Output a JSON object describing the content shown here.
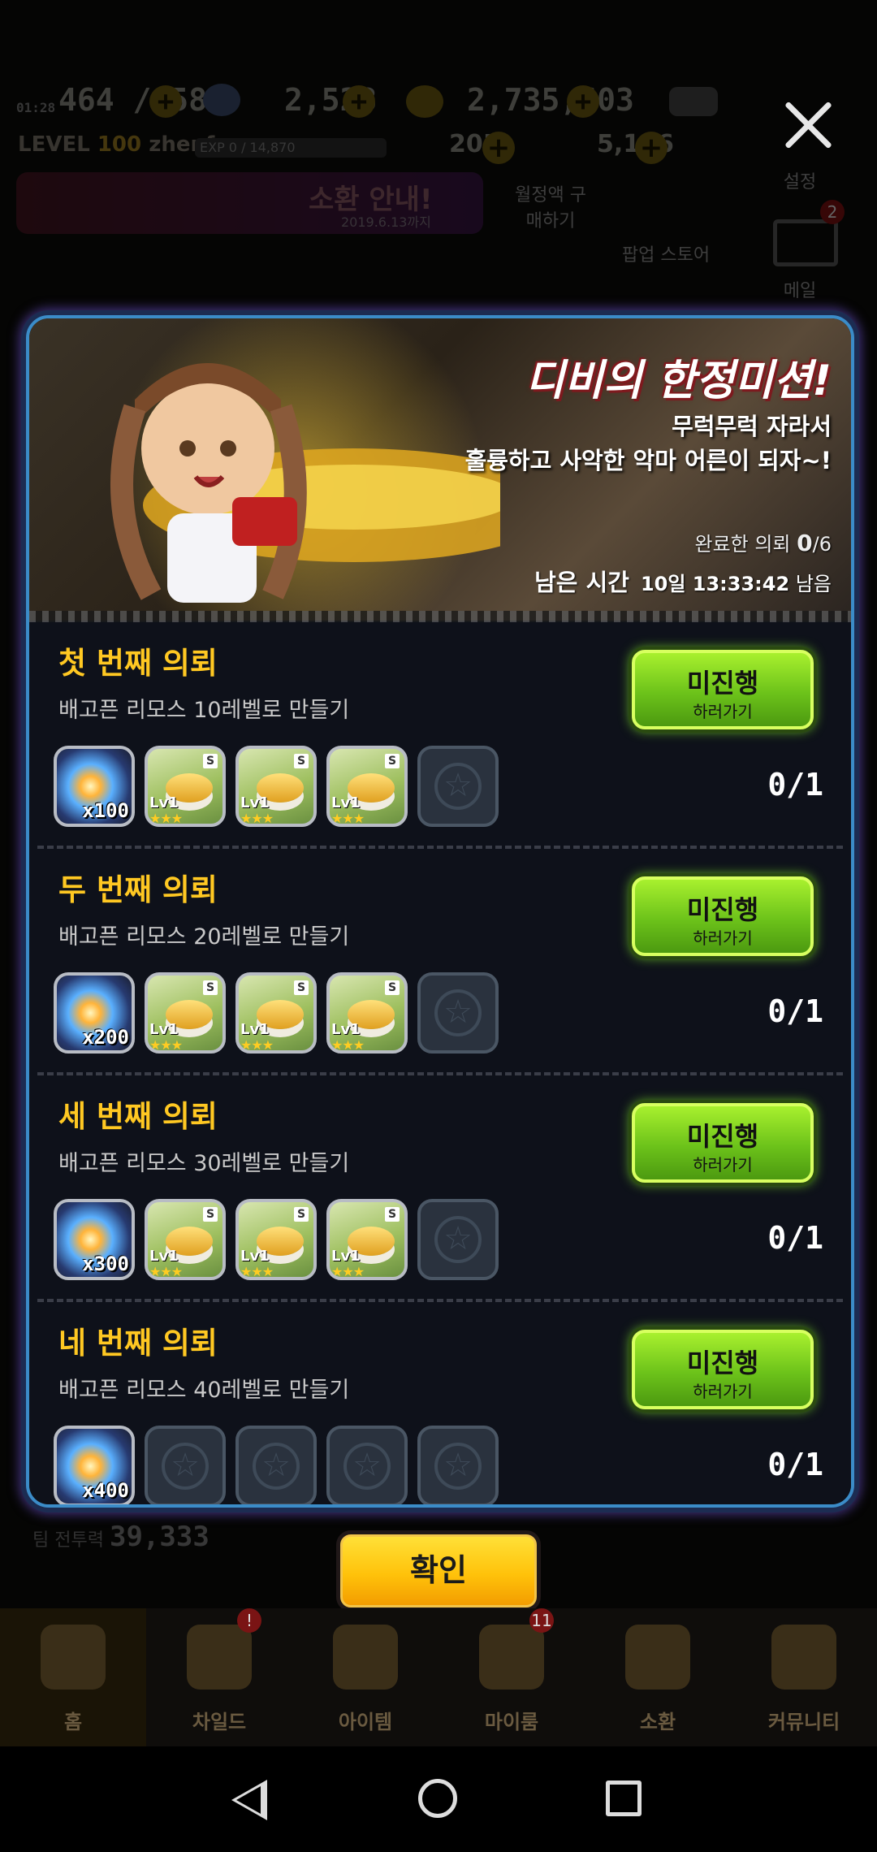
{
  "status": {
    "time": "01:28",
    "stamina": "464 / 584",
    "gems": "2,523",
    "gold": "2,735,603",
    "level_label": "LEVEL",
    "level": "100",
    "player": "zhenfeng",
    "exp": "EXP 0 / 14,870",
    "sub1": "205",
    "sub2": "5,126"
  },
  "side": {
    "settings_label": "설정",
    "mail_label": "메일",
    "mail_badge": "2",
    "popup_label": "팝업 스토어",
    "monthly_label": "월정액 구매하기",
    "banner_text": "소환 안내!",
    "banner_date": "2019.6.13까지"
  },
  "modal": {
    "title": "디비의 한정미션!",
    "subtitle_line1": "무럭무럭 자라서",
    "subtitle_line2": "훌륭하고 사악한 악마 어른이 되자~!",
    "completed_label": "완료한 의뢰",
    "completed_value": "0",
    "completed_total": "/6",
    "time_label": "남은 시간",
    "time_value": "10일 13:33:42",
    "time_suffix": "남음"
  },
  "missions": [
    {
      "title": "첫 번째 의뢰",
      "desc": "배고픈 리모스 10레벨로 만들기",
      "gem_qty": "x100",
      "button_main": "미진행",
      "button_sub": "하러가기",
      "progress": "0/1",
      "pet_rewards": 3
    },
    {
      "title": "두 번째 의뢰",
      "desc": "배고픈 리모스 20레벨로 만들기",
      "gem_qty": "x200",
      "button_main": "미진행",
      "button_sub": "하러가기",
      "progress": "0/1",
      "pet_rewards": 3
    },
    {
      "title": "세 번째 의뢰",
      "desc": "배고픈 리모스 30레벨로 만들기",
      "gem_qty": "x300",
      "button_main": "미진행",
      "button_sub": "하러가기",
      "progress": "0/1",
      "pet_rewards": 3
    },
    {
      "title": "네 번째 의뢰",
      "desc": "배고픈 리모스 40레벨로 만들기",
      "gem_qty": "x400",
      "button_main": "미진행",
      "button_sub": "하러가기",
      "progress": "0/1",
      "pet_rewards": 0
    }
  ],
  "reward_item": {
    "level": "Lv1",
    "tag": "S",
    "stars": "★★★"
  },
  "confirm_label": "확인",
  "team_power_label": "팀 전투력",
  "team_power": "39,333",
  "tabs": [
    {
      "label": "홈",
      "icon": "home-icon"
    },
    {
      "label": "차일드",
      "icon": "child-icon",
      "badge": "!"
    },
    {
      "label": "아이템",
      "icon": "item-icon"
    },
    {
      "label": "마이룸",
      "icon": "myroom-icon",
      "badge": "11"
    },
    {
      "label": "소환",
      "icon": "summon-icon"
    },
    {
      "label": "커뮤니티",
      "icon": "community-icon"
    }
  ],
  "colors": {
    "accent": "#ffc822",
    "button_green": "#8ede28",
    "confirm_yellow": "#ffc20a",
    "modal_border": "#3b8cc8"
  }
}
